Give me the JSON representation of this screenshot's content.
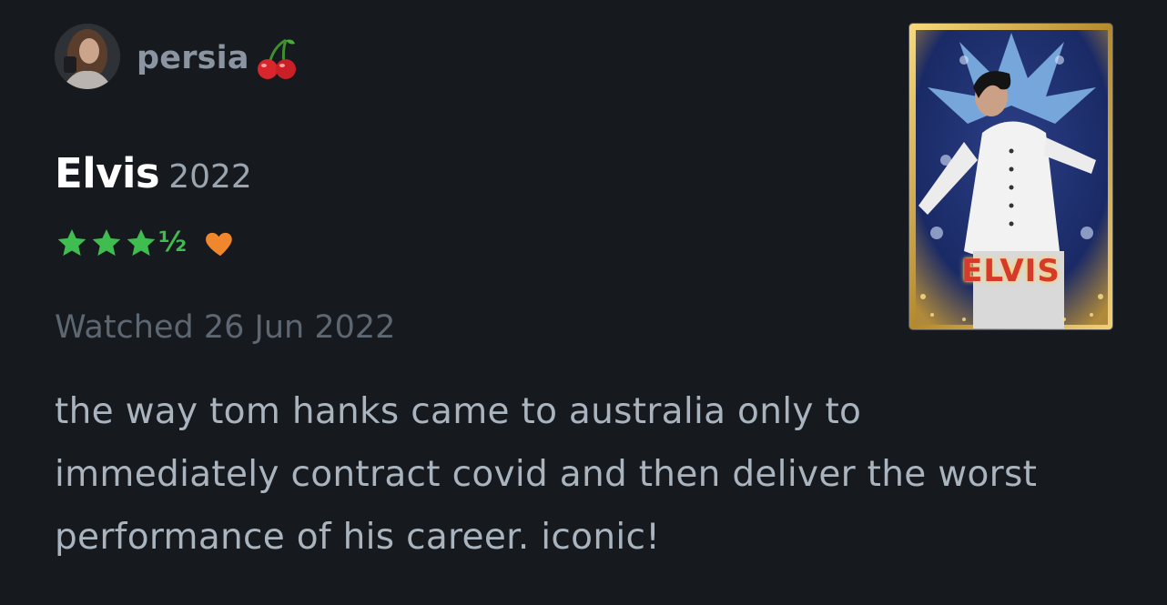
{
  "user": {
    "name": "persia",
    "emoji_icon": "cherry-icon"
  },
  "film": {
    "title": "Elvis",
    "year": "2022"
  },
  "rating": {
    "stars": 3.5,
    "half_glyph": "½",
    "liked": true,
    "star_color": "#40bd50",
    "heart_color": "#f0872c"
  },
  "watched": "Watched 26 Jun 2022",
  "review": "the way tom hanks came to australia only to immediately contract covid and then deliver the worst performance of his career. iconic!",
  "poster": {
    "title_text": "ELVIS"
  }
}
